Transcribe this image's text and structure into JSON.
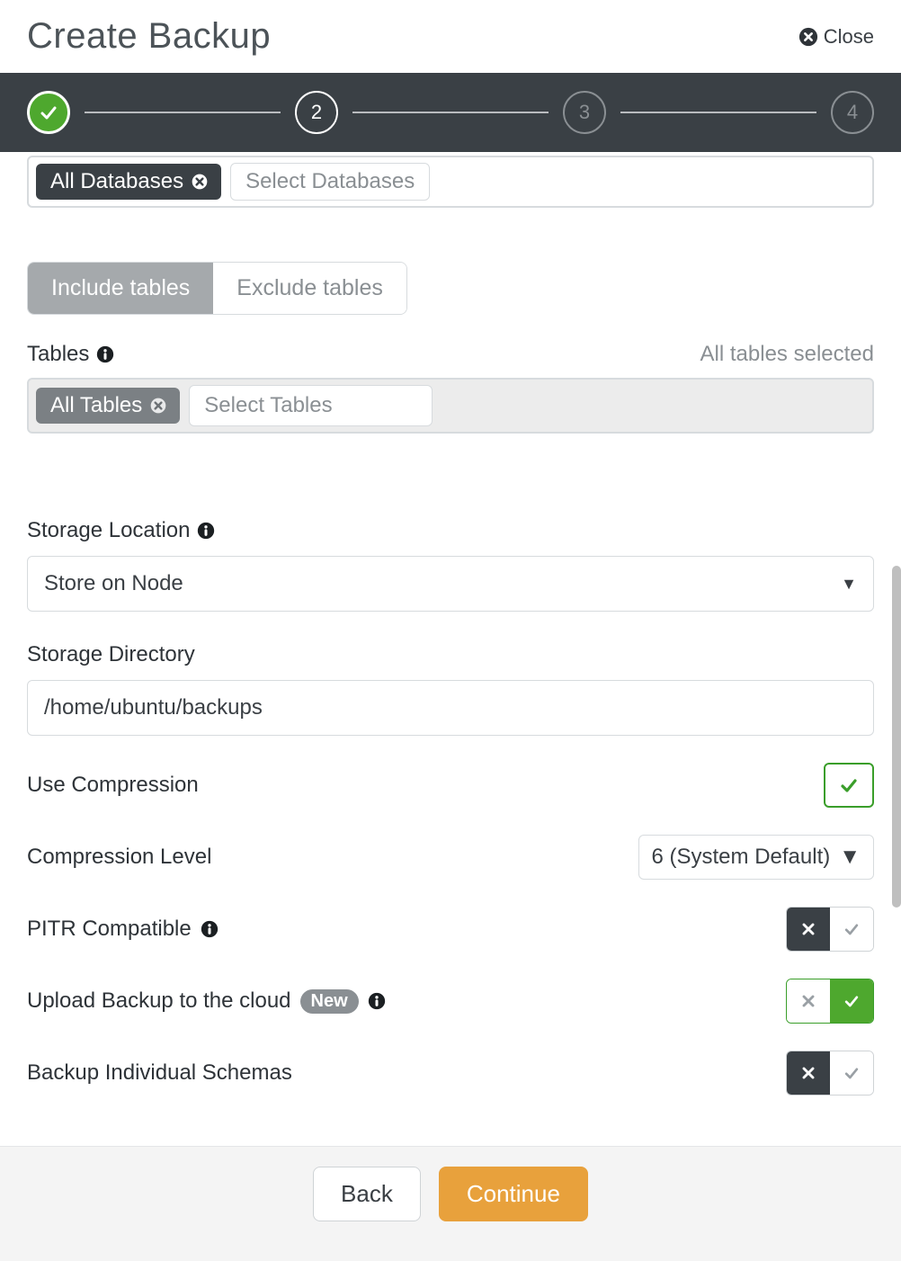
{
  "header": {
    "title": "Create Backup",
    "close": "Close"
  },
  "stepper": {
    "current": 2,
    "steps": [
      "done",
      "2",
      "3",
      "4"
    ]
  },
  "databases": {
    "chip": "All Databases",
    "placeholder": "Select Databases"
  },
  "tables": {
    "toggle": {
      "include": "Include tables",
      "exclude": "Exclude tables"
    },
    "label": "Tables",
    "summary": "All tables selected",
    "chip": "All Tables",
    "placeholder": "Select Tables"
  },
  "storage": {
    "location_label": "Storage Location",
    "location_value": "Store on Node",
    "directory_label": "Storage Directory",
    "directory_value": "/home/ubuntu/backups"
  },
  "options": {
    "use_compression": "Use Compression",
    "compression_level_label": "Compression Level",
    "compression_level_value": "6 (System Default)",
    "pitr": "PITR Compatible",
    "upload_cloud": "Upload Backup to the cloud",
    "new_badge": "New",
    "individual_schemas": "Backup Individual Schemas"
  },
  "footer": {
    "back": "Back",
    "continue": "Continue"
  }
}
